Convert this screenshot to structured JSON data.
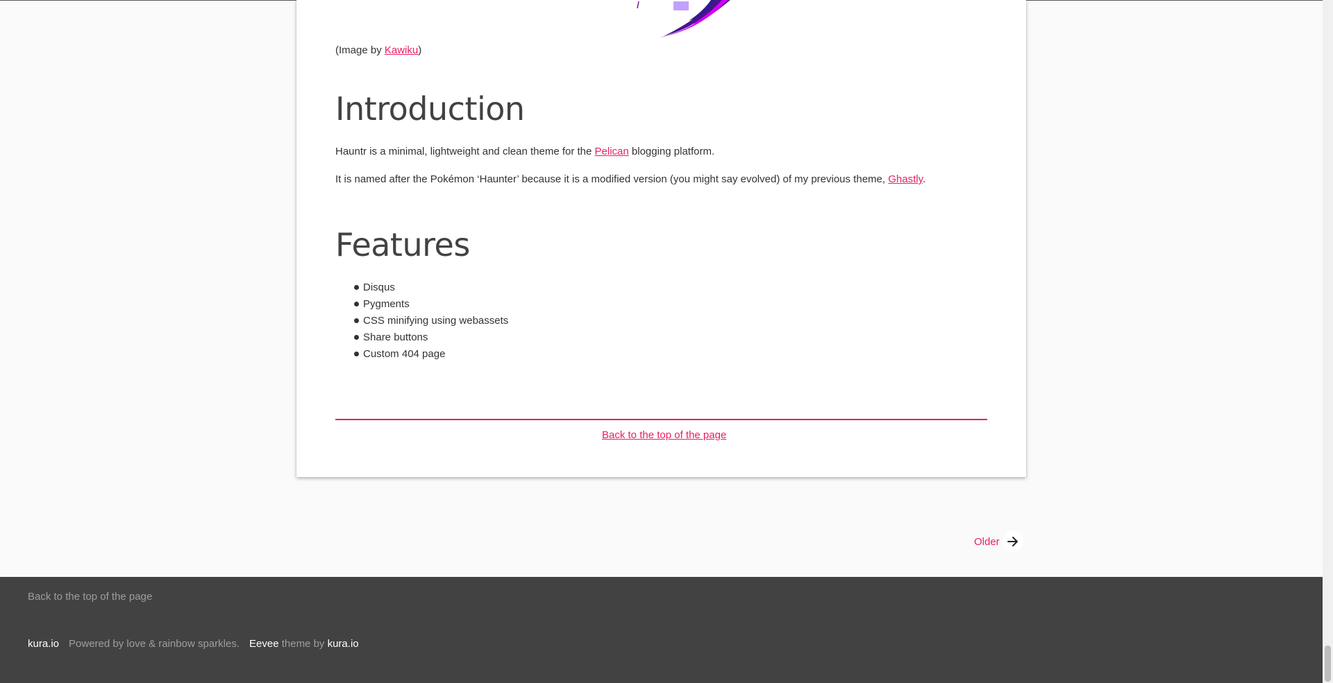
{
  "colors": {
    "accent": "#e91e63",
    "footer_bg": "#424242",
    "page_bg": "#fafafa"
  },
  "caption": {
    "prefix": "(Image by ",
    "link": "Kawiku",
    "suffix": ")"
  },
  "intro": {
    "heading": "Introduction",
    "p1": {
      "before": "Hauntr is a minimal, lightweight and clean theme for the ",
      "link": "Pelican",
      "after": " blogging platform."
    },
    "p2": {
      "before": "It is named after the Pokémon ‘Haunter’ because it is a modified version (you might say evolved) of my previous theme, ",
      "link": "Ghastly",
      "after": "."
    }
  },
  "features": {
    "heading": "Features",
    "items": [
      "Disqus",
      "Pygments",
      "CSS minifying using webassets",
      "Share buttons",
      "Custom 404 page"
    ]
  },
  "card_back_to_top": "Back to the top of the page",
  "pagination": {
    "older_label": "Older",
    "icon": "arrow-right-icon"
  },
  "footer": {
    "back_to_top": "Back to the top of the page",
    "site": "kura.io",
    "powered": "Powered by love & rainbow sparkles.",
    "theme_name": "Eevee",
    "theme_by": " theme by ",
    "theme_author": "kura.io"
  }
}
